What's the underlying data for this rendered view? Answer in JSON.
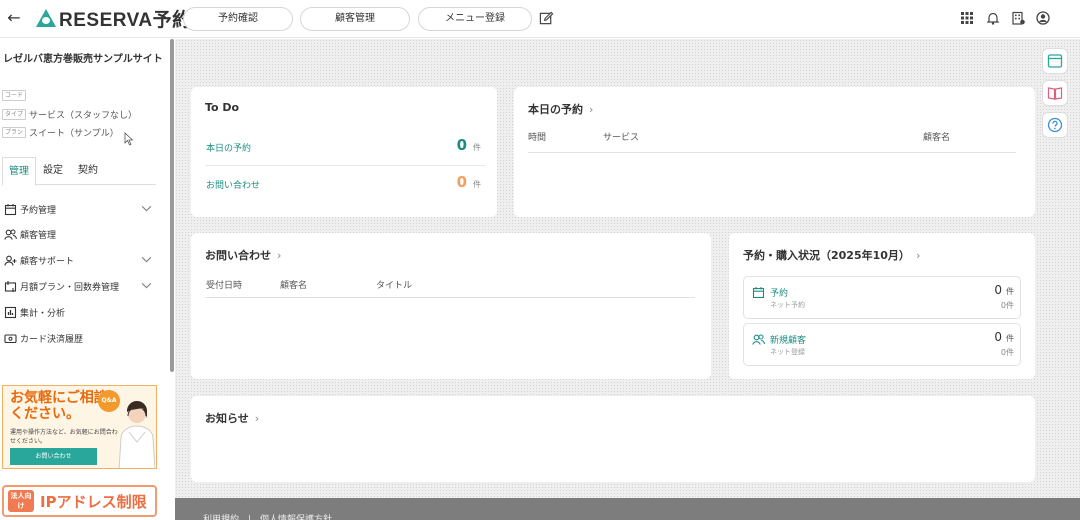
{
  "app": {
    "logo_text": "RESERVA予約"
  },
  "topnav": [
    {
      "label": "予約確認"
    },
    {
      "label": "顧客管理"
    },
    {
      "label": "メニュー登録"
    }
  ],
  "sidebar": {
    "site_name": "レゼルバ恵方巻販売サンプルサイト",
    "meta": [
      {
        "tag": "コード",
        "value": ""
      },
      {
        "tag": "タイプ",
        "value": "サービス（スタッフなし）"
      },
      {
        "tag": "プラン",
        "value": "スイート（サンプル）"
      }
    ],
    "tabs": [
      {
        "label": "管理"
      },
      {
        "label": "設定"
      },
      {
        "label": "契約"
      }
    ],
    "menu": [
      {
        "label": "予約管理",
        "icon": "calendar-icon",
        "expandable": true
      },
      {
        "label": "顧客管理",
        "icon": "users-icon",
        "expandable": false
      },
      {
        "label": "顧客サポート",
        "icon": "user-plus-icon",
        "expandable": true
      },
      {
        "label": "月額プラン・回数券管理",
        "icon": "repeat-icon",
        "expandable": true
      },
      {
        "label": "集計・分析",
        "icon": "chart-icon",
        "expandable": false
      },
      {
        "label": "カード決済履歴",
        "icon": "card-icon",
        "expandable": false
      }
    ],
    "banner_contact": {
      "title": "お気軽にご相談ください。",
      "badge": "Q&A",
      "sub": "運用や操作方法など、お気軽にお問合わせください。",
      "button": "お問い合わせ"
    },
    "banner_ip": {
      "badge": "法人向け",
      "text": "IPアドレス制限"
    }
  },
  "todo": {
    "title": "To Do",
    "rows": [
      {
        "label": "本日の予約",
        "count": "0",
        "unit": "件",
        "color": "#1d8c82"
      },
      {
        "label": "お問い合わせ",
        "count": "0",
        "unit": "件",
        "color": "#f0a060"
      }
    ]
  },
  "today": {
    "title": "本日の予約",
    "columns": [
      "時間",
      "サービス",
      "顧客名"
    ]
  },
  "inquiry": {
    "title": "お問い合わせ",
    "columns": [
      "受付日時",
      "顧客名",
      "タイトル"
    ]
  },
  "status": {
    "title": "予約・購入状況（2025年10月）",
    "items": [
      {
        "label": "予約",
        "sub": "ネット予約",
        "count": "0",
        "unit": "件",
        "sub_count": "0件",
        "icon": "calendar-icon"
      },
      {
        "label": "新規顧客",
        "sub": "ネット登録",
        "count": "0",
        "unit": "件",
        "sub_count": "0件",
        "icon": "users-icon"
      }
    ]
  },
  "news": {
    "title": "お知らせ"
  },
  "footer": {
    "text": "利用規約　|　個人情報保護方針"
  },
  "colors": {
    "accent": "#2aa79b",
    "link": "#1d8c82",
    "orange": "#f0a060"
  }
}
